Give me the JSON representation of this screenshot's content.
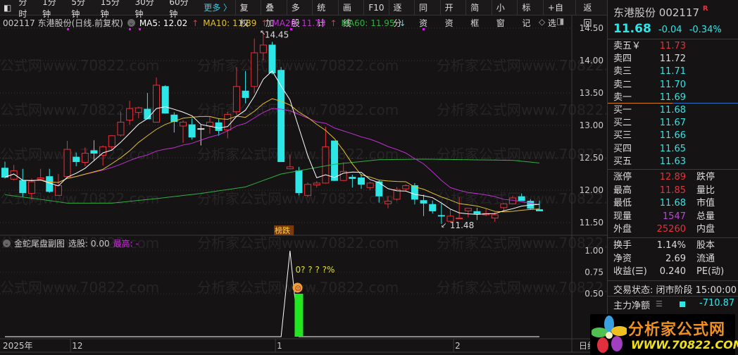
{
  "toolbar": {
    "periods": [
      "分时",
      "1分钟",
      "5分钟",
      "15分钟",
      "30分钟",
      "60分钟"
    ],
    "more": "更多 〉",
    "buttons": [
      "复权",
      "叠加",
      "多股",
      "统计",
      "画线",
      "F10",
      "逐分",
      "同资",
      "开资",
      "简框",
      "小窗",
      "标记",
      "+自选",
      "返回"
    ]
  },
  "legend": {
    "title": "002117 东港股份(日线.前复权)",
    "ma5": "MA5: 12.02",
    "ma10": "MA10: 11.89",
    "ma20": "MA20: 11.73",
    "ma60": "MA60: 11.95",
    "up_arrow": "↑",
    "down_arrow": "↓"
  },
  "colors": {
    "up": "#e8303a",
    "down": "#2ee6e6",
    "ma5": "#ffffff",
    "ma10": "#e0c030",
    "ma20": "#c030d0",
    "ma60": "#30b040",
    "sub_bar": "#22e622"
  },
  "watermark": "分析家公式网www.70822.com",
  "chart_data": {
    "type": "candlestick",
    "price_axis": {
      "ticks": [
        "14.50",
        "14.00",
        "13.50",
        "13.00",
        "12.50",
        "12.00",
        "11.50"
      ],
      "range": [
        11.35,
        14.5
      ]
    },
    "time_axis": {
      "labels": [
        {
          "text": "2025年",
          "index": 0
        },
        {
          "text": "12",
          "index": 8
        },
        {
          "text": "1",
          "index": 31
        },
        {
          "text": "2",
          "index": 51
        }
      ],
      "period": "日线"
    },
    "annotations": {
      "high": "14.45",
      "high_index": 29,
      "low": "11.48",
      "low_index": 49,
      "tag": "榜跌",
      "tag_index": 31
    },
    "ohlc": [
      [
        12.34,
        12.44,
        12.18,
        12.2
      ],
      [
        12.17,
        12.39,
        12.15,
        12.3
      ],
      [
        12.15,
        12.33,
        11.9,
        11.96
      ],
      [
        11.95,
        12.18,
        11.85,
        12.13
      ],
      [
        12.17,
        12.33,
        12.15,
        12.19
      ],
      [
        12.21,
        12.33,
        11.96,
        11.98
      ],
      [
        11.92,
        12.25,
        11.92,
        12.07
      ],
      [
        12.21,
        12.76,
        12.21,
        12.63
      ],
      [
        12.51,
        12.58,
        12.37,
        12.44
      ],
      [
        12.43,
        12.66,
        12.37,
        12.57
      ],
      [
        12.61,
        12.77,
        12.46,
        12.57
      ],
      [
        12.54,
        12.69,
        12.38,
        12.67
      ],
      [
        12.67,
        12.85,
        12.62,
        12.84
      ],
      [
        12.85,
        13.21,
        12.83,
        13.05
      ],
      [
        13.08,
        13.38,
        13.01,
        13.26
      ],
      [
        13.2,
        13.29,
        13.11,
        13.27
      ],
      [
        13.25,
        13.5,
        13.1,
        13.1
      ],
      [
        13.05,
        13.74,
        13.05,
        13.62
      ],
      [
        13.6,
        13.62,
        13.18,
        13.19
      ],
      [
        13.16,
        13.2,
        12.89,
        13.06
      ],
      [
        12.99,
        13.08,
        12.73,
        13.05
      ],
      [
        13.01,
        13.11,
        12.78,
        12.82
      ],
      [
        12.95,
        13.01,
        12.69,
        12.95
      ],
      [
        12.99,
        13.13,
        12.87,
        13.05
      ],
      [
        13.04,
        13.11,
        12.84,
        12.92
      ],
      [
        12.93,
        13.21,
        12.8,
        13.17
      ],
      [
        13.21,
        13.9,
        13.16,
        13.6
      ],
      [
        13.53,
        13.84,
        13.34,
        13.43
      ],
      [
        13.6,
        14.34,
        13.5,
        14.12
      ],
      [
        14.12,
        14.45,
        14.0,
        14.24
      ],
      [
        14.24,
        14.29,
        13.79,
        13.81
      ],
      [
        13.85,
        13.9,
        12.44,
        12.44
      ],
      [
        12.33,
        12.55,
        12.32,
        12.36
      ],
      [
        12.3,
        12.36,
        11.92,
        11.96
      ],
      [
        11.92,
        12.12,
        11.89,
        12.09
      ],
      [
        12.08,
        12.14,
        12.04,
        12.11
      ],
      [
        12.11,
        12.98,
        12.1,
        12.67
      ],
      [
        12.76,
        12.76,
        12.14,
        12.15
      ],
      [
        12.15,
        12.43,
        12.14,
        12.29
      ],
      [
        12.2,
        12.24,
        12.04,
        12.18
      ],
      [
        12.19,
        12.25,
        12.02,
        12.09
      ],
      [
        12.04,
        12.13,
        12.0,
        12.11
      ],
      [
        12.13,
        12.15,
        11.81,
        11.91
      ],
      [
        11.79,
        11.91,
        11.72,
        11.83
      ],
      [
        11.86,
        12.05,
        11.84,
        12.01
      ],
      [
        12.02,
        12.09,
        11.98,
        12.07
      ],
      [
        12.07,
        12.11,
        11.78,
        11.86
      ],
      [
        11.84,
        11.93,
        11.6,
        11.8
      ],
      [
        11.78,
        11.84,
        11.64,
        11.68
      ],
      [
        11.61,
        11.79,
        11.48,
        11.6
      ],
      [
        11.52,
        11.7,
        11.5,
        11.6
      ],
      [
        11.56,
        11.89,
        11.56,
        11.57
      ],
      [
        11.68,
        11.72,
        11.58,
        11.72
      ],
      [
        11.67,
        11.73,
        11.54,
        11.64
      ],
      [
        11.62,
        11.71,
        11.6,
        11.64
      ],
      [
        11.57,
        11.66,
        11.51,
        11.62
      ],
      [
        11.73,
        11.8,
        11.67,
        11.79
      ],
      [
        11.79,
        11.91,
        11.78,
        11.88
      ],
      [
        11.9,
        11.95,
        11.84,
        11.84
      ],
      [
        11.83,
        11.86,
        11.7,
        11.72
      ],
      [
        11.7,
        11.84,
        11.68,
        11.68
      ]
    ],
    "ma60_points": [
      [
        0,
        11.93
      ],
      [
        5,
        11.84
      ],
      [
        7,
        11.8
      ],
      [
        12,
        11.8
      ],
      [
        17,
        11.87
      ],
      [
        22,
        11.95
      ],
      [
        27,
        12.05
      ],
      [
        31,
        12.25
      ],
      [
        33,
        12.3
      ],
      [
        37,
        12.4
      ],
      [
        42,
        12.47
      ],
      [
        47,
        12.48
      ],
      [
        52,
        12.47
      ],
      [
        57,
        12.46
      ],
      [
        60,
        12.42
      ]
    ],
    "sub": {
      "title": "金蛇尾盘副图",
      "pick": "选股: 0.00",
      "high_label": "最高: -",
      "ticks": [
        "1.00",
        "0.75",
        "0.50"
      ],
      "range": [
        0,
        1
      ],
      "line_peak_index": 32,
      "line_peak": 1.0,
      "bar_index": 33,
      "bar_value": 0.5,
      "text": "0? ? ? ?%",
      "emoji": "☹"
    }
  },
  "quote": {
    "name": "东港股份",
    "code": "002117",
    "badge": "R",
    "price": "11.68",
    "change": "-0.04",
    "pct": "-0.34%"
  },
  "sell": [
    {
      "label": "卖五￥",
      "price": "11.73",
      "c": "rd"
    },
    {
      "label": "卖四",
      "price": "11.72",
      "c": "wt"
    },
    {
      "label": "卖三",
      "price": "11.71",
      "c": "cy"
    },
    {
      "label": "卖二",
      "price": "11.70",
      "c": "cy"
    },
    {
      "label": "卖一",
      "price": "11.69",
      "c": "cy"
    }
  ],
  "buy": [
    {
      "label": "买一",
      "price": "11.68"
    },
    {
      "label": "买二",
      "price": "11.67"
    },
    {
      "label": "买三",
      "price": "11.66"
    },
    {
      "label": "买四",
      "price": "11.65"
    },
    {
      "label": "买五",
      "price": "11.63"
    }
  ],
  "stats1": [
    {
      "l": "涨停",
      "v": "12.89",
      "c": "rd",
      "l2": "跌停"
    },
    {
      "l": "最高",
      "v": "11.85",
      "c": "rd",
      "l2": "量比"
    },
    {
      "l": "最低",
      "v": "11.68",
      "c": "cy",
      "l2": "市值"
    },
    {
      "l": "现量",
      "v": "1547",
      "c": "pp",
      "l2": "总量"
    },
    {
      "l": "外盘",
      "v": "25260",
      "c": "rd",
      "l2": "内盘"
    }
  ],
  "stats2": [
    {
      "l": "换手",
      "v": "1.14%",
      "c": "wt",
      "l2": "股本"
    },
    {
      "l": "净资",
      "v": "2.69",
      "c": "wt",
      "l2": "流通"
    },
    {
      "l": "收益(☰)",
      "v": "0.240",
      "c": "wt",
      "l2": "PE(动)"
    }
  ],
  "status": "交易状态: 闭市阶段 15:00:00",
  "capital": {
    "label": "主力净额",
    "value": "-710.87"
  },
  "logo": {
    "cn": "分析家公式网",
    "url": "WWW.70822.COM"
  }
}
